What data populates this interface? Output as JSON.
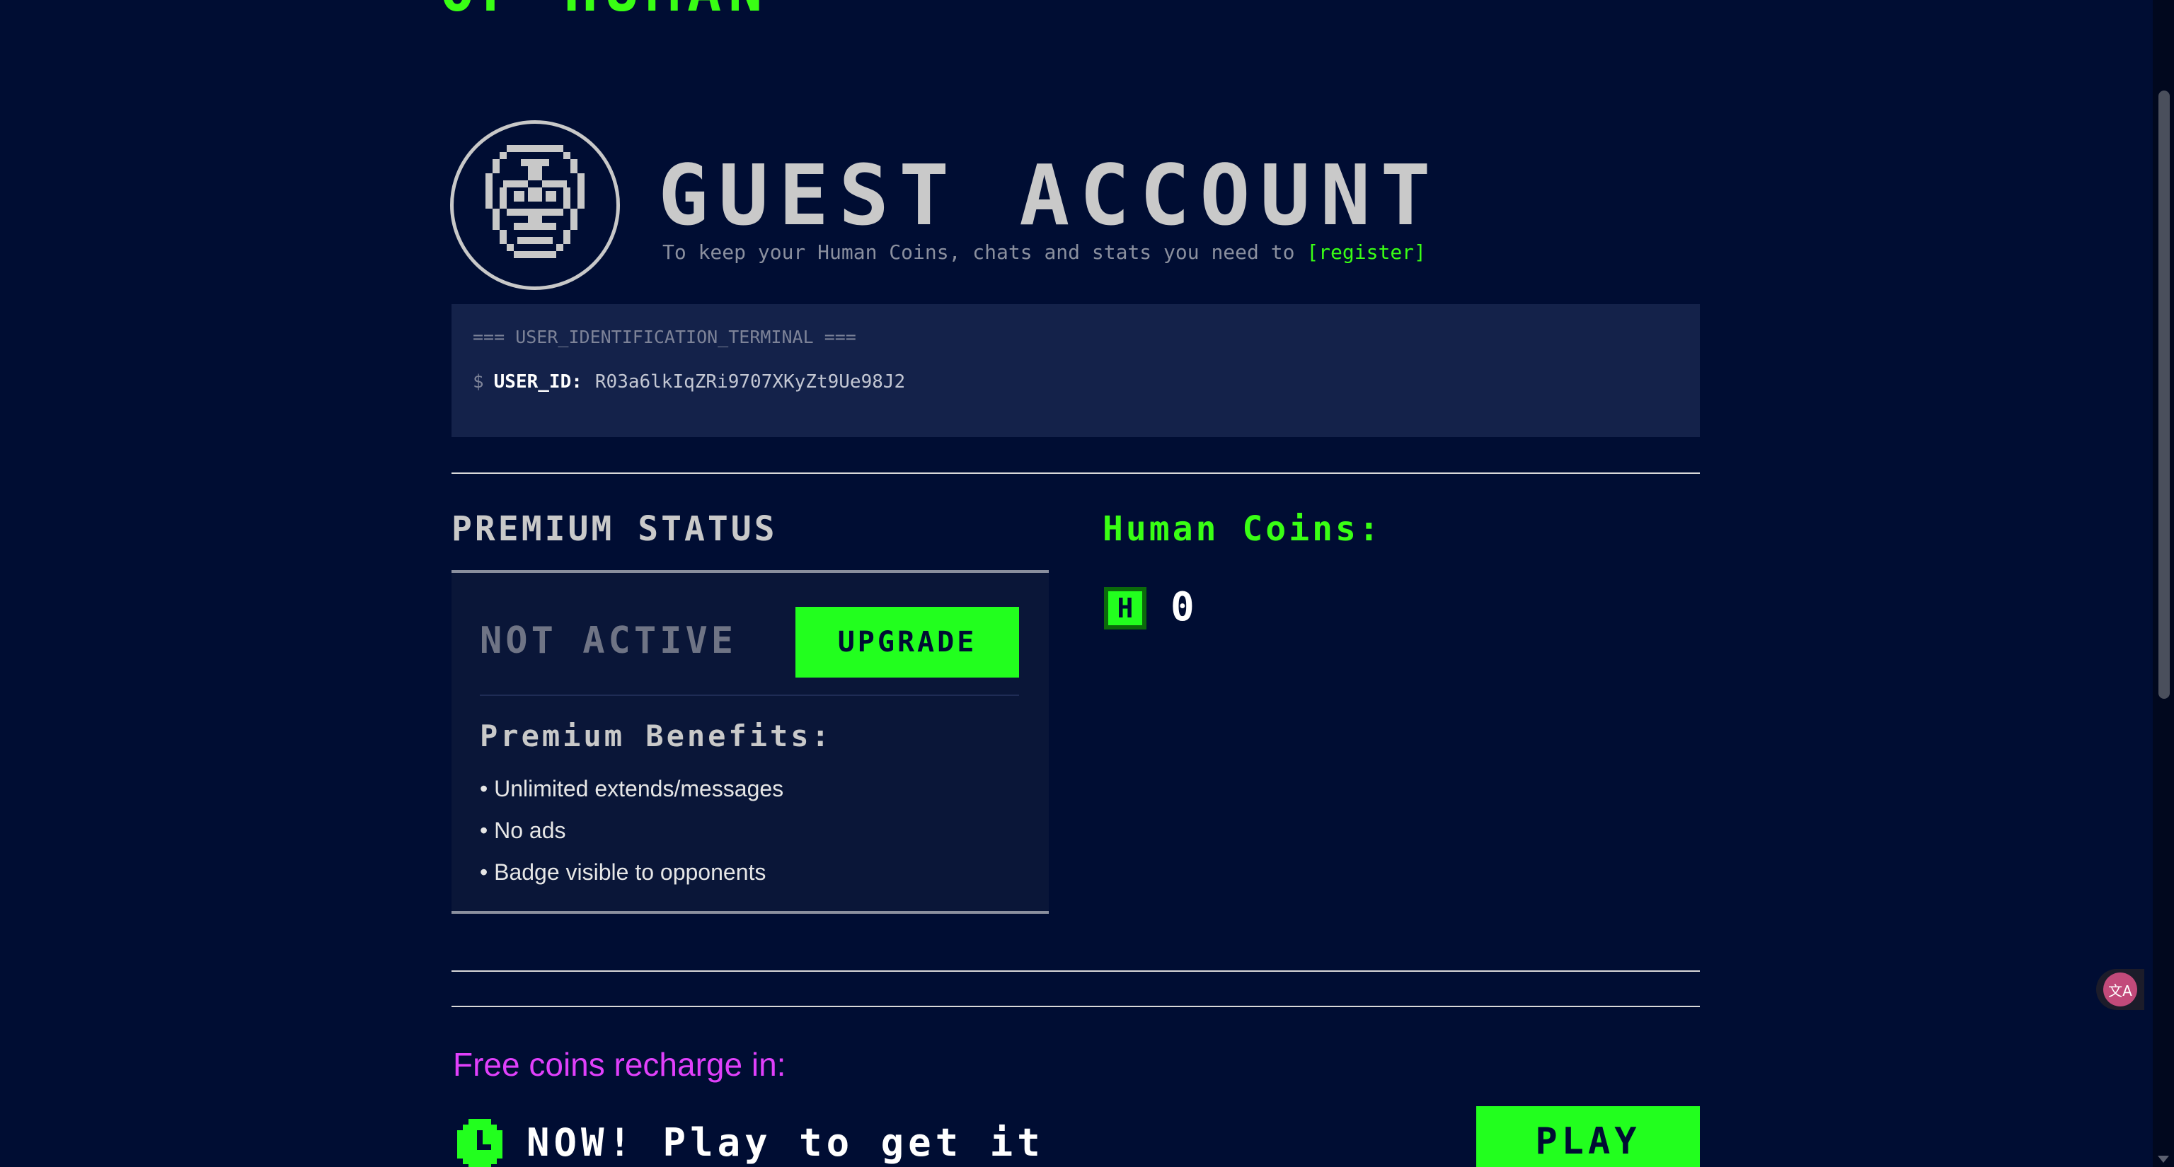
{
  "header": {
    "top_heading": "OF HUMAN"
  },
  "account": {
    "title": "GUEST ACCOUNT",
    "subtitle": "To keep your Human Coins, chats and stats you need to",
    "register_link": "[register]"
  },
  "terminal": {
    "header": "=== USER_IDENTIFICATION_TERMINAL ===",
    "prompt": "$",
    "user_id_label": "USER_ID:",
    "user_id_value": "R03a6lkIqZRi9707XKyZt9Ue98J2"
  },
  "premium": {
    "title": "PREMIUM STATUS",
    "status": "NOT ACTIVE",
    "upgrade_label": "UPGRADE",
    "benefits_title": "Premium Benefits:",
    "benefits": [
      "Unlimited extends/messages",
      "No ads",
      "Badge visible to opponents"
    ]
  },
  "coins": {
    "title": "Human Coins:",
    "icon_letter": "H",
    "count": "0"
  },
  "recharge": {
    "label": "Free coins recharge in:",
    "status": "NOW! Play to get it",
    "play_label": "PLAY"
  },
  "colors": {
    "background": "#000d33",
    "accent_green": "#22ff1e",
    "magenta": "#e040fb",
    "panel": "#14224a"
  },
  "icons": {
    "avatar": "robot-face-icon",
    "coin": "human-coin-icon",
    "clock": "clock-icon",
    "translate": "translate-icon"
  }
}
